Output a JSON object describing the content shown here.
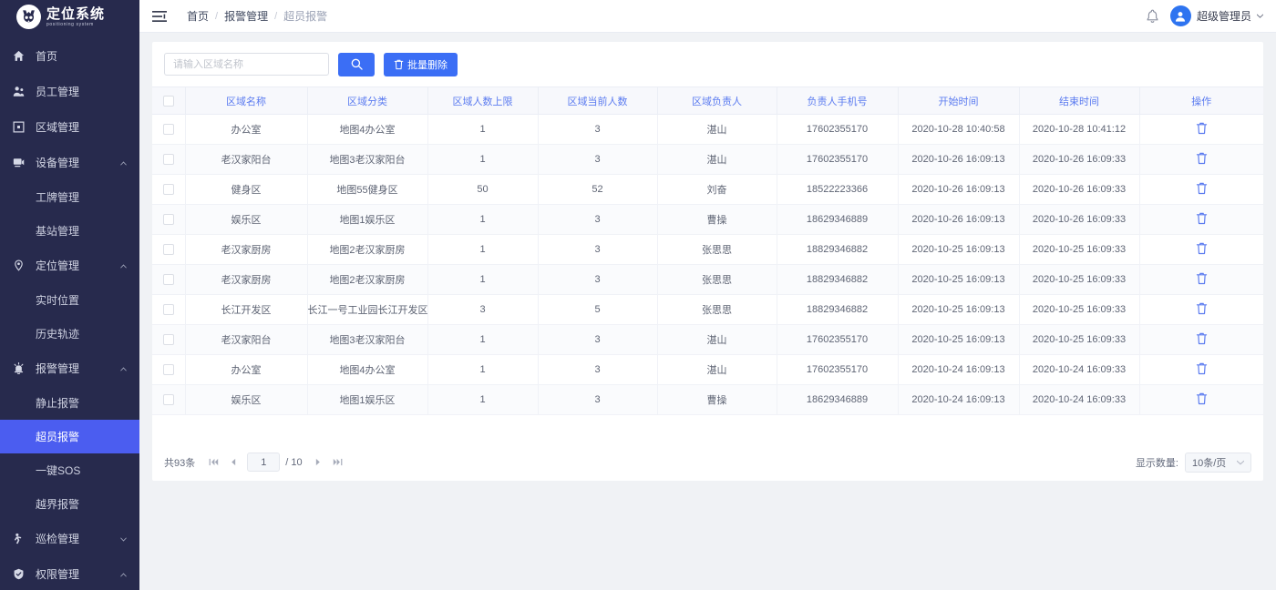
{
  "brand": {
    "title": "定位系统",
    "subtitle": "positioning system",
    "logo_icon": "owl-logo-icon"
  },
  "sidebar": {
    "items": [
      {
        "label": "首页",
        "icon": "home-icon",
        "type": "item",
        "expandable": false
      },
      {
        "label": "员工管理",
        "icon": "users-icon",
        "type": "item",
        "expandable": false
      },
      {
        "label": "区域管理",
        "icon": "square-region-icon",
        "type": "item",
        "expandable": false
      },
      {
        "label": "设备管理",
        "icon": "device-icon",
        "type": "item",
        "expandable": true,
        "expanded": true
      },
      {
        "label": "工牌管理",
        "type": "sub"
      },
      {
        "label": "基站管理",
        "type": "sub"
      },
      {
        "label": "定位管理",
        "icon": "location-pin-icon",
        "type": "item",
        "expandable": true,
        "expanded": true
      },
      {
        "label": "实时位置",
        "type": "sub"
      },
      {
        "label": "历史轨迹",
        "type": "sub"
      },
      {
        "label": "报警管理",
        "icon": "alarm-icon",
        "type": "item",
        "expandable": true,
        "expanded": true
      },
      {
        "label": "静止报警",
        "type": "sub"
      },
      {
        "label": "超员报警",
        "type": "sub",
        "active": true
      },
      {
        "label": "一键SOS",
        "type": "sub"
      },
      {
        "label": "越界报警",
        "type": "sub"
      },
      {
        "label": "巡检管理",
        "icon": "inspection-icon",
        "type": "item",
        "expandable": true,
        "expanded": false
      },
      {
        "label": "权限管理",
        "icon": "shield-icon",
        "type": "item",
        "expandable": true,
        "expanded": true
      }
    ]
  },
  "topbar": {
    "menu_toggle_icon": "hamburger-icon",
    "breadcrumb": [
      "首页",
      "报警管理",
      "超员报警"
    ],
    "breadcrumb_separator": "/",
    "notification_icon": "bell-icon",
    "avatar_icon": "user-avatar-icon",
    "user_name": "超级管理员",
    "user_caret_icon": "chevron-down-icon"
  },
  "toolbar": {
    "search_placeholder": "请输入区域名称",
    "search_value": "",
    "search_icon": "search-icon",
    "search_button_label": "",
    "bulk_delete_label": "批量删除",
    "bulk_delete_icon": "trash-icon"
  },
  "table": {
    "columns": [
      "区域名称",
      "区域分类",
      "区域人数上限",
      "区域当前人数",
      "区域负责人",
      "负责人手机号",
      "开始时间",
      "结束时间",
      "操作"
    ],
    "row_action_icon": "trash-icon",
    "rows": [
      {
        "name": "办公室",
        "category": "地图4办公室",
        "limit": "1",
        "current": "3",
        "manager": "湛山",
        "phone": "17602355170",
        "start": "2020-10-28 10:40:58",
        "end": "2020-10-28 10:41:12"
      },
      {
        "name": "老汉家阳台",
        "category": "地图3老汉家阳台",
        "limit": "1",
        "current": "3",
        "manager": "湛山",
        "phone": "17602355170",
        "start": "2020-10-26 16:09:13",
        "end": "2020-10-26 16:09:33"
      },
      {
        "name": "健身区",
        "category": "地图55健身区",
        "limit": "50",
        "current": "52",
        "manager": "刘奋",
        "phone": "18522223366",
        "start": "2020-10-26 16:09:13",
        "end": "2020-10-26 16:09:33"
      },
      {
        "name": "娱乐区",
        "category": "地图1娱乐区",
        "limit": "1",
        "current": "3",
        "manager": "曹操",
        "phone": "18629346889",
        "start": "2020-10-26 16:09:13",
        "end": "2020-10-26 16:09:33"
      },
      {
        "name": "老汉家厨房",
        "category": "地图2老汉家厨房",
        "limit": "1",
        "current": "3",
        "manager": "张思思",
        "phone": "18829346882",
        "start": "2020-10-25 16:09:13",
        "end": "2020-10-25 16:09:33"
      },
      {
        "name": "老汉家厨房",
        "category": "地图2老汉家厨房",
        "limit": "1",
        "current": "3",
        "manager": "张思思",
        "phone": "18829346882",
        "start": "2020-10-25 16:09:13",
        "end": "2020-10-25 16:09:33"
      },
      {
        "name": "长江开发区",
        "category": "长江一号工业园长江开发区",
        "limit": "3",
        "current": "5",
        "manager": "张思思",
        "phone": "18829346882",
        "start": "2020-10-25 16:09:13",
        "end": "2020-10-25 16:09:33"
      },
      {
        "name": "老汉家阳台",
        "category": "地图3老汉家阳台",
        "limit": "1",
        "current": "3",
        "manager": "湛山",
        "phone": "17602355170",
        "start": "2020-10-25 16:09:13",
        "end": "2020-10-25 16:09:33"
      },
      {
        "name": "办公室",
        "category": "地图4办公室",
        "limit": "1",
        "current": "3",
        "manager": "湛山",
        "phone": "17602355170",
        "start": "2020-10-24 16:09:13",
        "end": "2020-10-24 16:09:33"
      },
      {
        "name": "娱乐区",
        "category": "地图1娱乐区",
        "limit": "1",
        "current": "3",
        "manager": "曹操",
        "phone": "18629346889",
        "start": "2020-10-24 16:09:13",
        "end": "2020-10-24 16:09:33"
      }
    ]
  },
  "pagination": {
    "total_label": "共93条",
    "first_icon": "page-first-icon",
    "prev_icon": "page-prev-icon",
    "current_page": "1",
    "total_pages_label": "/ 10",
    "next_icon": "page-next-icon",
    "last_icon": "page-last-icon",
    "page_size_label": "显示数量:",
    "page_size_value": "10条/页",
    "page_size_caret_icon": "chevron-down-icon"
  },
  "colors": {
    "sidebar_bg": "#272a4d",
    "accent": "#3b6ef5",
    "active_menu": "#4b5df0",
    "header_text": "#5b7bf0"
  }
}
